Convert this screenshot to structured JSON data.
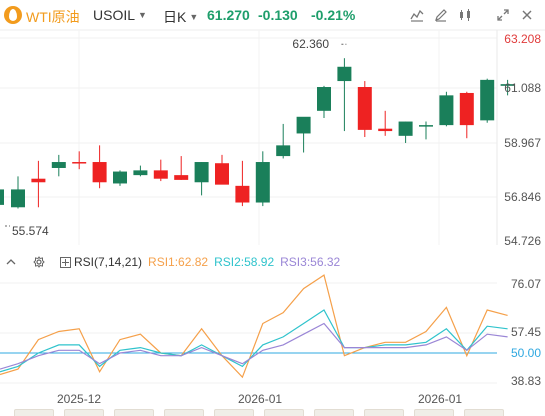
{
  "header": {
    "symbol_name": "WTI原油",
    "code": "USOIL",
    "period": "日K",
    "price": "61.270",
    "change": "-0.130",
    "change_pct": "-0.21%",
    "price_color": "#1e9e6b",
    "symbol_color": "#f29b1d",
    "tools": [
      "chart-type-icon",
      "draw-icon",
      "candle-settings-icon",
      "expand-icon",
      "close-icon"
    ]
  },
  "main_axis": {
    "labels": [
      "63.208",
      "61.088",
      "58.967",
      "56.846",
      "54.726"
    ],
    "highlight_color": "#e03b3b"
  },
  "annotations": {
    "high": "62.360",
    "low": "55.574"
  },
  "rsi": {
    "title": "RSI(7,14,21)",
    "rsi1_label": "RSI1:62.82",
    "rsi2_label": "RSI2:58.92",
    "rsi3_label": "RSI3:56.32",
    "rsi1_color": "#f5a04a",
    "rsi2_color": "#2fc3cc",
    "rsi3_color": "#9a86d6",
    "axis_labels": [
      "76.07",
      "57.45",
      "50.00",
      "38.83"
    ]
  },
  "x_axis": {
    "labels": [
      "2025-12",
      "2026-01",
      "2026-01"
    ]
  },
  "chart_data": {
    "type": "candlestick",
    "up_color": "#1a7f5a",
    "down_color": "#ee2222",
    "ylim": [
      54.726,
      63.208
    ],
    "candles": [
      {
        "o": 56.1,
        "h": 57.4,
        "l": 56.05,
        "c": 56.85
      },
      {
        "o": 57.3,
        "h": 58.05,
        "l": 56.1,
        "c": 57.15
      },
      {
        "o": 57.75,
        "h": 58.3,
        "l": 57.4,
        "c": 58.0
      },
      {
        "o": 58.0,
        "h": 58.45,
        "l": 57.7,
        "c": 57.95
      },
      {
        "o": 58.0,
        "h": 58.7,
        "l": 56.9,
        "c": 57.15
      },
      {
        "o": 57.1,
        "h": 57.65,
        "l": 57.0,
        "c": 57.6
      },
      {
        "o": 57.45,
        "h": 57.85,
        "l": 57.4,
        "c": 57.65
      },
      {
        "o": 57.65,
        "h": 58.1,
        "l": 57.2,
        "c": 57.3
      },
      {
        "o": 57.45,
        "h": 58.25,
        "l": 57.25,
        "c": 57.25
      },
      {
        "o": 57.15,
        "h": 58.0,
        "l": 56.6,
        "c": 58.0
      },
      {
        "o": 57.95,
        "h": 58.3,
        "l": 57.1,
        "c": 57.05
      },
      {
        "o": 57.0,
        "h": 58.05,
        "l": 56.15,
        "c": 56.3
      },
      {
        "o": 56.3,
        "h": 58.45,
        "l": 56.15,
        "c": 58.0
      },
      {
        "o": 58.25,
        "h": 59.6,
        "l": 58.15,
        "c": 58.7
      },
      {
        "o": 59.2,
        "h": 59.85,
        "l": 58.4,
        "c": 59.9
      },
      {
        "o": 60.15,
        "h": 61.2,
        "l": 59.85,
        "c": 61.15
      },
      {
        "o": 61.4,
        "h": 62.36,
        "l": 59.3,
        "c": 62.0
      },
      {
        "o": 61.15,
        "h": 61.4,
        "l": 59.05,
        "c": 59.35
      },
      {
        "o": 59.4,
        "h": 60.15,
        "l": 59.1,
        "c": 59.3
      },
      {
        "o": 59.1,
        "h": 59.7,
        "l": 58.8,
        "c": 59.7
      },
      {
        "o": 59.55,
        "h": 59.7,
        "l": 58.95,
        "c": 59.55
      },
      {
        "o": 59.55,
        "h": 60.95,
        "l": 59.5,
        "c": 60.8
      },
      {
        "o": 60.9,
        "h": 60.95,
        "l": 59.0,
        "c": 59.55
      },
      {
        "o": 59.75,
        "h": 61.5,
        "l": 59.65,
        "c": 61.45
      },
      {
        "o": 61.2,
        "h": 61.45,
        "l": 60.8,
        "c": 61.27
      }
    ],
    "rsi_ylim": [
      38.83,
      76.07
    ],
    "rsi1": [
      44,
      55,
      58,
      59,
      43,
      55,
      57,
      50,
      49,
      59,
      49,
      41,
      61,
      65,
      74,
      79,
      49,
      52,
      54,
      54,
      58,
      67,
      49,
      66,
      64
    ],
    "rsi2": [
      45,
      50,
      53,
      53,
      45,
      51,
      52,
      50,
      49,
      53,
      49,
      45,
      53,
      56,
      61,
      66,
      52,
      52,
      53,
      53,
      54,
      59,
      51,
      60,
      59
    ],
    "rsi3": [
      46,
      49,
      51,
      51,
      46,
      50,
      51,
      49,
      49,
      52,
      49,
      46,
      51,
      53,
      57,
      61,
      52,
      52,
      52,
      52,
      53,
      56,
      51,
      57,
      56
    ],
    "rsi_ref": 50.0
  }
}
